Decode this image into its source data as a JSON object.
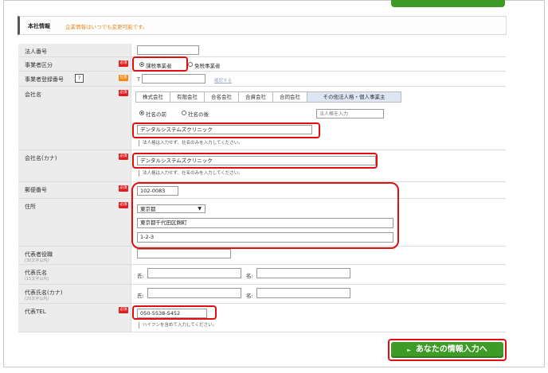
{
  "header": {
    "title": "本社情報",
    "note": "企業情報はいつでも変更可能です。"
  },
  "badges": {
    "required": "必須",
    "optional": "任意"
  },
  "help_mark": "?",
  "rows": {
    "corp_no": {
      "label": "法人番号",
      "value": ""
    },
    "business_type": {
      "label": "事業者区分",
      "options": [
        "課税事業者",
        "免税事業者"
      ],
      "selected": "課税事業者"
    },
    "reg_no": {
      "label": "事業者登録番号",
      "prefix": "T",
      "value": "",
      "link": "確認する"
    },
    "company": {
      "label": "会社名",
      "tabs": [
        "株式会社",
        "有限会社",
        "合名会社",
        "合資会社",
        "合同会社",
        "その他法人格・個人事業主"
      ],
      "position_options": [
        "社名の前",
        "社名の後"
      ],
      "position_selected": "社名の前",
      "legal_placeholder": "法人格を入力",
      "value": "デンタルシステムズクリニック",
      "hint": "法人格は入力せず、社名のみを入力してください。"
    },
    "company_kana": {
      "label": "会社名(カナ)",
      "value": "デンタルシステムズクリニック",
      "hint": "法人格は入力せず、社名のみを入力してください。"
    },
    "postal": {
      "label": "郵便番号",
      "value": "102-0083"
    },
    "address": {
      "label": "住所",
      "prefecture": "東京都",
      "city": "東京都千代田区麹町",
      "street": "1-2-3"
    },
    "rep_title": {
      "label": "代表者役職",
      "sub": "(30文字以内)",
      "value": ""
    },
    "rep_name": {
      "label": "代表氏名",
      "sub": "(15文字以内)",
      "last_label": "氏:",
      "first_label": "名:",
      "last": "",
      "first": ""
    },
    "rep_kana": {
      "label": "代表氏名(カナ)",
      "sub": "(20文字以内)",
      "last_label": "氏:",
      "first_label": "名:",
      "last": "",
      "first": ""
    },
    "rep_tel": {
      "label": "代表TEL",
      "value": "050-5538-5452",
      "hint": "ハイフンを含めて入力してください。"
    }
  },
  "next_button": "あなたの情報入力へ",
  "colors": {
    "highlight": "#e01010",
    "button": "#3e9b28",
    "required_badge": "#e02020",
    "optional_badge": "#f08a1a"
  }
}
